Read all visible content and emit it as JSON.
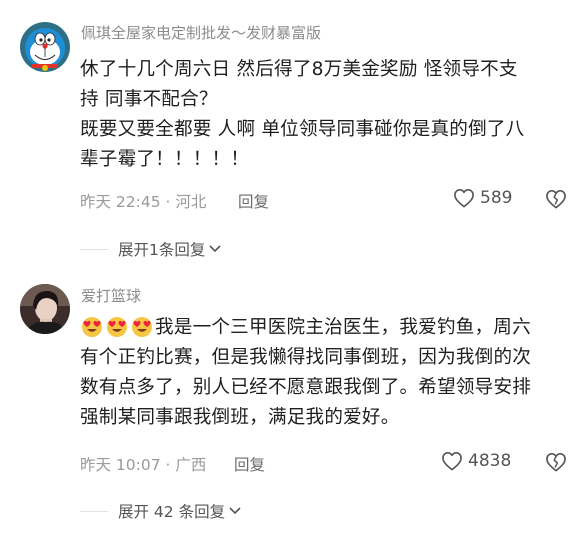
{
  "comments": [
    {
      "username": "佩琪全屋家电定制批发～发财暴富版",
      "lines": [
        "休了十几个周六日 然后得了8万美金奖励  怪领导不支",
        "持 同事不配合？",
        "既要又要全都要 人啊  单位领导同事碰你是真的倒了八",
        "辈子霉了！！！！！"
      ],
      "time_location": "昨天 22:45 · 河北",
      "reply_label": "回复",
      "likes": "589",
      "expand_label": "展开1条回复",
      "avatar_icon": "doraemon-avatar"
    },
    {
      "username": "爱打篮球",
      "emoji_count": 3,
      "emoji_icon": "heart-eyes-emoji",
      "lines": [
        "我是一个三甲医院主治医生，我爱钓鱼，周六",
        "有个正钓比赛，但是我懒得找同事倒班，因为我倒的次",
        "数有点多了，别人已经不愿意跟我倒了。希望领导安排",
        "强制某同事跟我倒班，满足我的爱好。"
      ],
      "time_location": "昨天 10:07 · 广西",
      "reply_label": "回复",
      "likes": "4838",
      "expand_label": "展开 42 条回复",
      "avatar_icon": "portrait-avatar"
    }
  ],
  "colors": {
    "text": "#1f1f1f",
    "muted": "#9a9a9a",
    "username": "#8c8c8c"
  }
}
